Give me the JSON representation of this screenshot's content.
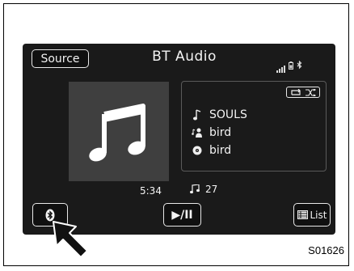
{
  "header": {
    "source_label": "Source",
    "title": "BT Audio",
    "status_icons": [
      "signal-bars-icon",
      "battery-icon",
      "bluetooth-icon"
    ]
  },
  "album_art": {
    "icon": "music-note-icon"
  },
  "info": {
    "controls_icons": [
      "repeat-icon",
      "shuffle-icon"
    ],
    "song": "SOULS",
    "artist": "bird",
    "album": "bird"
  },
  "playback": {
    "time": "5:34",
    "track_number": "27"
  },
  "controls": {
    "bluetooth_icon": "bluetooth-icon",
    "play_pause_label": "▶/II",
    "list_label": "List"
  },
  "figure_label": "S01626",
  "colors": {
    "screen_bg": "#1a1a1a",
    "text": "#f4f4f4",
    "art_bg": "#3f3f3f",
    "border": "#e8e8e8"
  }
}
